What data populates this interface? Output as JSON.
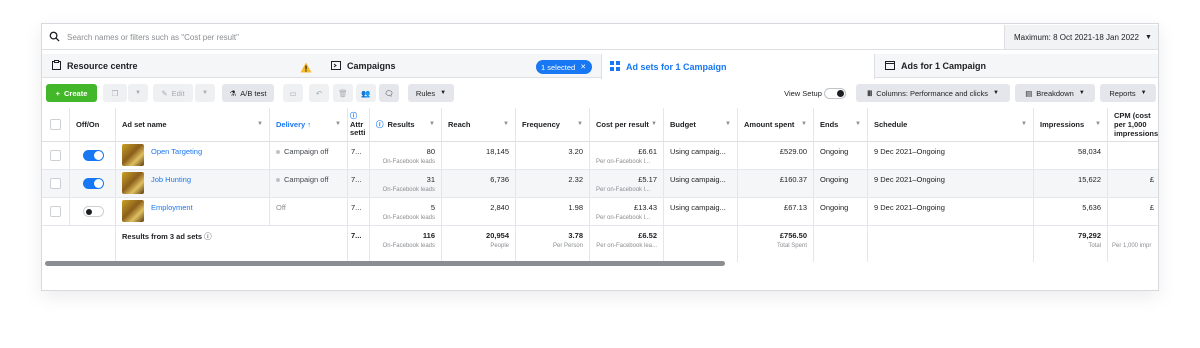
{
  "search": {
    "placeholder": "Search names or filters such as \"Cost per result\""
  },
  "date_range": {
    "label": "Maximum: 8 Oct 2021-18 Jan 2022"
  },
  "tabs": {
    "resource": "Resource centre",
    "campaigns": "Campaigns",
    "selected_pill": "1 selected",
    "adsets": "Ad sets for 1 Campaign",
    "ads": "Ads for 1 Campaign"
  },
  "toolbar": {
    "create": "Create",
    "edit": "Edit",
    "ab_test": "A/B test",
    "rules": "Rules",
    "view_setup": "View Setup",
    "columns": "Columns: Performance and clicks",
    "breakdown": "Breakdown",
    "reports": "Reports"
  },
  "columns": {
    "off_on": "Off/On",
    "ad_set_name": "Ad set name",
    "delivery": "Delivery ↑",
    "attr": "Attr setti",
    "results": "Results",
    "reach": "Reach",
    "frequency": "Frequency",
    "cost_per_result": "Cost per result",
    "budget": "Budget",
    "amount_spent": "Amount spent",
    "ends": "Ends",
    "schedule": "Schedule",
    "impressions": "Impressions",
    "cpm": "CPM (cost per 1,000 impressions)"
  },
  "rows": [
    {
      "name": "Open Targeting",
      "on": true,
      "delivery": "Campaign off",
      "attr": "7...",
      "results": "80",
      "results_sub": "On-Facebook leads",
      "reach": "18,145",
      "frequency": "3.20",
      "cpr": "£6.61",
      "cpr_sub": "Per on-Facebook l...",
      "budget": "Using campaig...",
      "spent": "£529.00",
      "ends": "Ongoing",
      "schedule": "9 Dec 2021–Ongoing",
      "impressions": "58,034",
      "cpm": ""
    },
    {
      "name": "Job Hunting",
      "on": true,
      "delivery": "Campaign off",
      "attr": "7...",
      "results": "31",
      "results_sub": "On-Facebook leads",
      "reach": "6,736",
      "frequency": "2.32",
      "cpr": "£5.17",
      "cpr_sub": "Per on-Facebook l...",
      "budget": "Using campaig...",
      "spent": "£160.37",
      "ends": "Ongoing",
      "schedule": "9 Dec 2021–Ongoing",
      "impressions": "15,622",
      "cpm": "£"
    },
    {
      "name": "Employment",
      "on": false,
      "delivery": "Off",
      "attr": "7...",
      "results": "5",
      "results_sub": "On-Facebook leads",
      "reach": "2,840",
      "frequency": "1.98",
      "cpr": "£13.43",
      "cpr_sub": "Per on-Facebook l...",
      "budget": "Using campaig...",
      "spent": "£67.13",
      "ends": "Ongoing",
      "schedule": "9 Dec 2021–Ongoing",
      "impressions": "5,636",
      "cpm": "£"
    }
  ],
  "totals": {
    "label": "Results from 3 ad sets",
    "attr": "7...",
    "results": "116",
    "results_sub": "On-Facebook leads",
    "reach": "20,954",
    "reach_sub": "People",
    "frequency": "3.78",
    "frequency_sub": "Per Person",
    "cpr": "£6.52",
    "cpr_sub": "Per on-Facebook lea...",
    "spent": "£756.50",
    "spent_sub": "Total Spent",
    "impressions": "79,292",
    "impressions_sub": "Total",
    "cpm_sub": "Per 1,000 impr"
  },
  "colors": {
    "accent": "#1877f2",
    "create": "#42b72a"
  }
}
